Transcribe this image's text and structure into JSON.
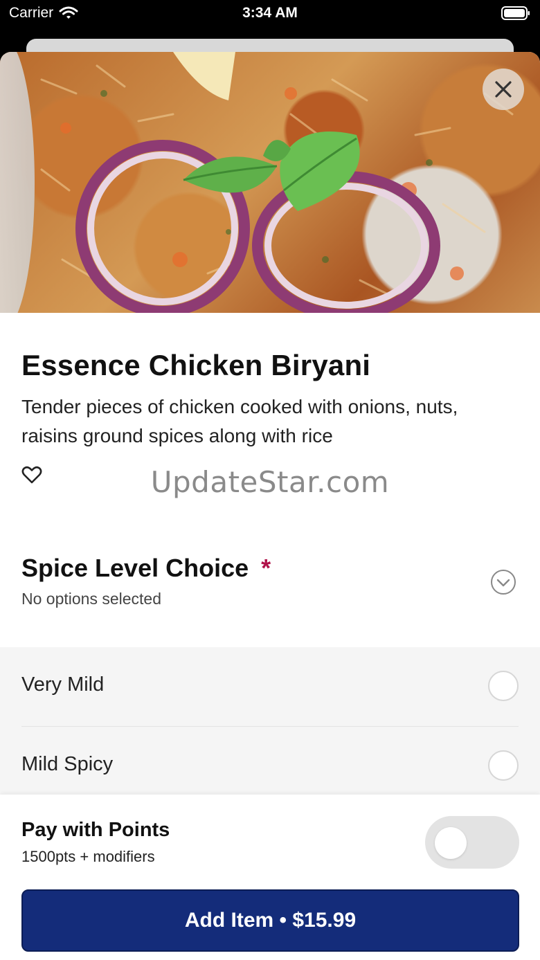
{
  "status_bar": {
    "carrier": "Carrier",
    "time": "3:34 AM",
    "wifi_icon": "wifi-icon",
    "battery_icon": "battery-icon"
  },
  "item": {
    "title": "Essence Chicken Biryani",
    "description": "Tender pieces of chicken cooked with onions, nuts, raisins ground spices along with rice",
    "favorite_icon": "heart-icon",
    "close_icon": "close-icon"
  },
  "watermark": "UpdateStar.com",
  "modifier_group": {
    "title": "Spice Level Choice",
    "required_marker": "*",
    "status": "No options selected",
    "expand_icon": "chevron-down-icon",
    "options": [
      {
        "label": "Very Mild",
        "selected": false
      },
      {
        "label": "Mild Spicy",
        "selected": false
      }
    ]
  },
  "footer": {
    "points_title": "Pay with Points",
    "points_subtitle": "1500pts + modifiers",
    "points_toggle_on": false,
    "add_button_label": "Add Item • $15.99"
  },
  "colors": {
    "primary_button": "#142c7a",
    "required_star": "#b0134a",
    "options_background": "#f5f5f5",
    "toggle_off": "#e3e3e3"
  }
}
